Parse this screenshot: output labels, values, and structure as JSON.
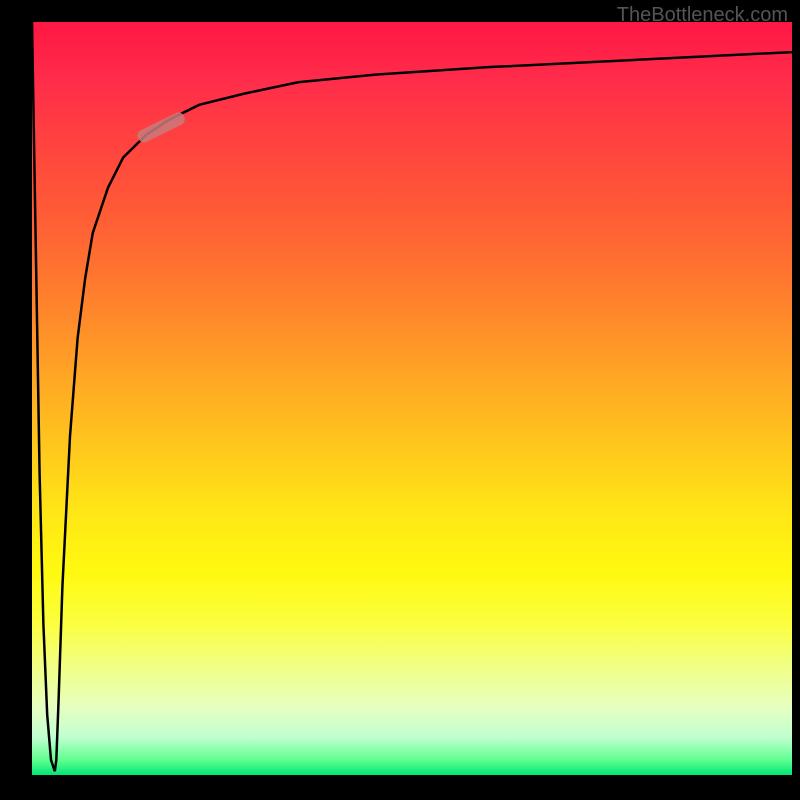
{
  "watermark": "TheBottleneck.com",
  "chart_data": {
    "type": "line",
    "title": "",
    "xlabel": "",
    "ylabel": "",
    "xlim": [
      0,
      100
    ],
    "ylim": [
      0,
      100
    ],
    "description": "Bottleneck curve starting near y=100 at x=0, dropping sharply to y≈0 near x≈3, then rising steeply in a logarithmic-like curve approaching y≈96 asymptotically at x=100. A highlighted segment marker appears on the rising curve around x≈14-20, y≈85-88.",
    "series": [
      {
        "name": "bottleneck-curve",
        "x": [
          0,
          0.5,
          1,
          1.5,
          2,
          2.5,
          3,
          3.2,
          3.5,
          4,
          5,
          6,
          7,
          8,
          10,
          12,
          15,
          18,
          22,
          28,
          35,
          45,
          60,
          80,
          100
        ],
        "y": [
          100,
          70,
          40,
          20,
          8,
          2,
          0.5,
          2,
          10,
          25,
          45,
          58,
          66,
          72,
          78,
          82,
          85,
          87,
          89,
          90.5,
          92,
          93,
          94,
          95,
          96
        ]
      }
    ],
    "highlight_marker": {
      "x_range": [
        14,
        20
      ],
      "y_range": [
        84.5,
        87.5
      ],
      "color": "#d88080"
    },
    "gradient_stops": [
      {
        "position": 0,
        "color": "#ff1744"
      },
      {
        "position": 50,
        "color": "#ffc400"
      },
      {
        "position": 85,
        "color": "#ffff5a"
      },
      {
        "position": 100,
        "color": "#00e676"
      }
    ]
  }
}
